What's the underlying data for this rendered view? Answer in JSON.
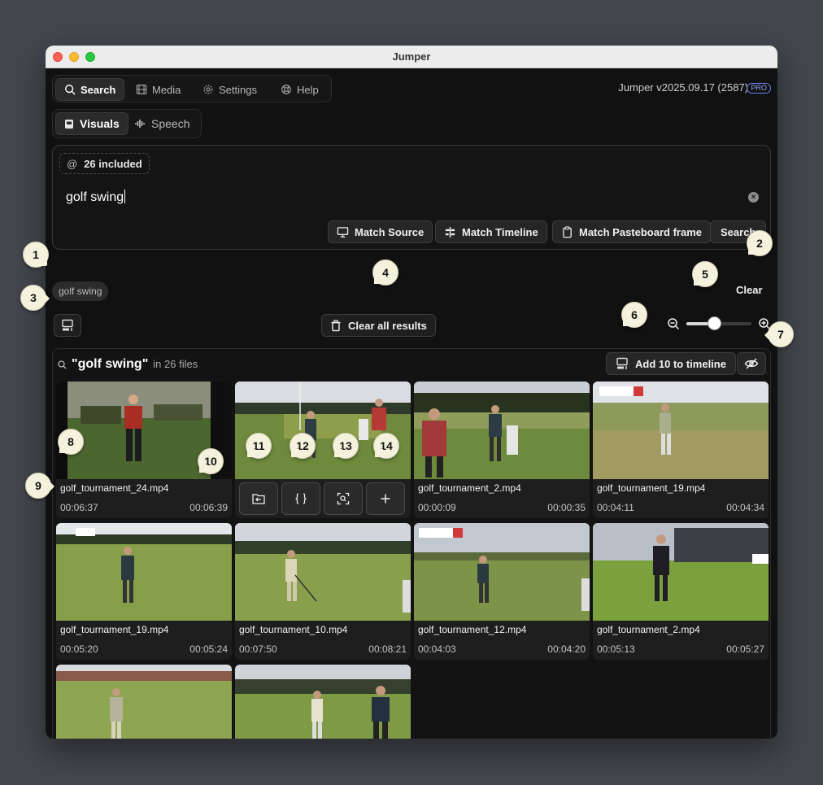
{
  "window": {
    "title": "Jumper"
  },
  "nav": {
    "tabs": [
      {
        "label": "Search",
        "icon": "search-icon",
        "active": true
      },
      {
        "label": "Media",
        "icon": "film-icon"
      },
      {
        "label": "Settings",
        "icon": "gear-icon"
      },
      {
        "label": "Help",
        "icon": "lifebuoy-icon"
      }
    ],
    "version": "Jumper v2025.09.17 (2587)",
    "badge": "PRO"
  },
  "modes": [
    {
      "label": "Visuals",
      "icon": "image-icon",
      "active": true
    },
    {
      "label": "Speech",
      "icon": "waveform-icon"
    }
  ],
  "search": {
    "scope_symbol": "@",
    "scope_label": "26 included",
    "query": "golf swing",
    "buttons": {
      "match_source": "Match Source",
      "match_timeline": "Match Timeline",
      "match_pasteboard": "Match Pasteboard frame",
      "search": "Search"
    }
  },
  "history_chip": "golf swing",
  "clear_label": "Clear",
  "clear_all_label": "Clear all results",
  "zoom": {
    "value": 0.43
  },
  "results": {
    "query": "\"golf swing\"",
    "subtitle": "in 26 files",
    "add_label": "Add 10 to timeline",
    "items": [
      {
        "name": "golf_tournament_24.mp4",
        "start": "00:06:37",
        "end": "00:06:39"
      },
      {
        "name": "",
        "start": "",
        "end": ""
      },
      {
        "name": "golf_tournament_2.mp4",
        "start": "00:00:09",
        "end": "00:00:35"
      },
      {
        "name": "golf_tournament_19.mp4",
        "start": "00:04:11",
        "end": "00:04:34"
      },
      {
        "name": "golf_tournament_19.mp4",
        "start": "00:05:20",
        "end": "00:05:24"
      },
      {
        "name": "golf_tournament_10.mp4",
        "start": "00:07:50",
        "end": "00:08:21"
      },
      {
        "name": "golf_tournament_12.mp4",
        "start": "00:04:03",
        "end": "00:04:20"
      },
      {
        "name": "golf_tournament_2.mp4",
        "start": "00:05:13",
        "end": "00:05:27"
      },
      {
        "name": "",
        "start": "",
        "end": ""
      },
      {
        "name": "",
        "start": "",
        "end": ""
      }
    ]
  },
  "callouts": [
    "1",
    "2",
    "3",
    "4",
    "5",
    "6",
    "7",
    "8",
    "9",
    "10",
    "11",
    "12",
    "13",
    "14"
  ],
  "colors": {
    "accent": "#7b8cff",
    "background": "#111111",
    "callout": "#f4f1dc"
  }
}
